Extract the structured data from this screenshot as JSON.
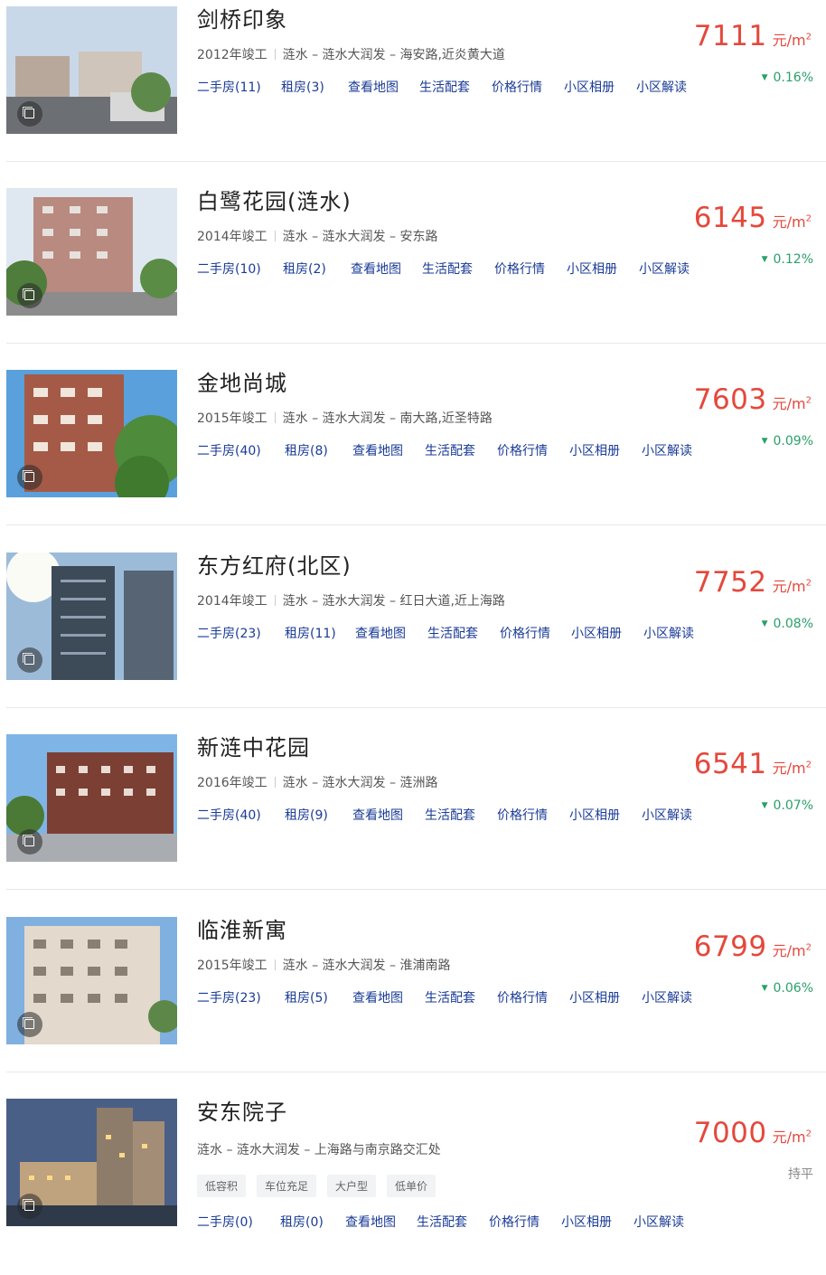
{
  "listings": [
    {
      "name": "剑桥印象",
      "year": "2012年竣工",
      "area": "涟水 – 涟水大润发 – 海安路,近炎黄大道",
      "links": [
        "二手房(11)",
        "租房(3)",
        "查看地图",
        "生活配套",
        "价格行情",
        "小区相册",
        "小区解读"
      ],
      "price": "7111",
      "unit": "元/m",
      "unit_sup": "2",
      "change": "0.16%",
      "trend": "down"
    },
    {
      "name": "白鹭花园(涟水)",
      "year": "2014年竣工",
      "area": "涟水 – 涟水大润发 – 安东路",
      "links": [
        "二手房(10)",
        "租房(2)",
        "查看地图",
        "生活配套",
        "价格行情",
        "小区相册",
        "小区解读"
      ],
      "price": "6145",
      "unit": "元/m",
      "unit_sup": "2",
      "change": "0.12%",
      "trend": "up"
    },
    {
      "name": "金地尚城",
      "year": "2015年竣工",
      "area": "涟水 – 涟水大润发 – 南大路,近圣特路",
      "links": [
        "二手房(40)",
        "租房(8)",
        "查看地图",
        "生活配套",
        "价格行情",
        "小区相册",
        "小区解读"
      ],
      "price": "7603",
      "unit": "元/m",
      "unit_sup": "2",
      "change": "0.09%",
      "trend": "down"
    },
    {
      "name": "东方红府(北区)",
      "year": "2014年竣工",
      "area": "涟水 – 涟水大润发 – 红日大道,近上海路",
      "links": [
        "二手房(23)",
        "租房(11)",
        "查看地图",
        "生活配套",
        "价格行情",
        "小区相册",
        "小区解读"
      ],
      "price": "7752",
      "unit": "元/m",
      "unit_sup": "2",
      "change": "0.08%",
      "trend": "down"
    },
    {
      "name": "新涟中花园",
      "year": "2016年竣工",
      "area": "涟水 – 涟水大润发 – 涟洲路",
      "links": [
        "二手房(40)",
        "租房(9)",
        "查看地图",
        "生活配套",
        "价格行情",
        "小区相册",
        "小区解读"
      ],
      "price": "6541",
      "unit": "元/m",
      "unit_sup": "2",
      "change": "0.07%",
      "trend": "down"
    },
    {
      "name": "临淮新寓",
      "year": "2015年竣工",
      "area": "涟水 – 涟水大润发 – 淮浦南路",
      "links": [
        "二手房(23)",
        "租房(5)",
        "查看地图",
        "生活配套",
        "价格行情",
        "小区相册",
        "小区解读"
      ],
      "price": "6799",
      "unit": "元/m",
      "unit_sup": "2",
      "change": "0.06%",
      "trend": "down"
    },
    {
      "name": "安东院子",
      "year": "",
      "area": "涟水 – 涟水大润发 – 上海路与南京路交汇处",
      "tags": [
        "低容积",
        "车位充足",
        "大户型",
        "低单价"
      ],
      "links": [
        "二手房(0)",
        "租房(0)",
        "查看地图",
        "生活配套",
        "价格行情",
        "小区相册",
        "小区解读"
      ],
      "price": "7000",
      "unit": "元/m",
      "unit_sup": "2",
      "change": "持平",
      "trend": "flat"
    }
  ],
  "icons": {
    "album": "photo-album-icon",
    "trend_down": "triangle-down-icon"
  },
  "colors": {
    "price": "#e5483c",
    "link": "#1a3b96",
    "trend": "#2aa06a",
    "flat": "#888888"
  }
}
